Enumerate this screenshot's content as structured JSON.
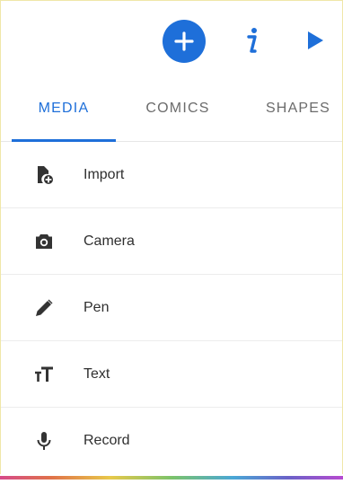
{
  "toolbar": {
    "add_icon": "plus-circle-icon",
    "info_icon": "info-icon",
    "play_icon": "play-icon",
    "accent_color": "#1e6fd9"
  },
  "tabs": [
    {
      "label": "MEDIA",
      "selected": true
    },
    {
      "label": "COMICS",
      "selected": false
    },
    {
      "label": "SHAPES",
      "selected": false
    }
  ],
  "menu": [
    {
      "label": "Import",
      "icon": "file-import-icon"
    },
    {
      "label": "Camera",
      "icon": "camera-icon"
    },
    {
      "label": "Pen",
      "icon": "pen-icon"
    },
    {
      "label": "Text",
      "icon": "text-size-icon"
    },
    {
      "label": "Record",
      "icon": "microphone-icon"
    }
  ]
}
